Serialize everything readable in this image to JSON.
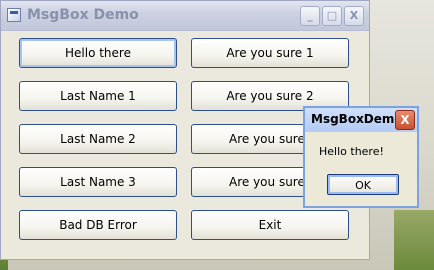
{
  "window": {
    "title": "MsgBox Demo",
    "minimize": "_",
    "maximize": "□",
    "close": "X"
  },
  "buttons": {
    "hello": "Hello there",
    "last1": "Last Name 1",
    "last2": "Last Name 2",
    "last3": "Last Name 3",
    "baddb": "Bad DB Error",
    "sure1": "Are you sure 1",
    "sure2": "Are you sure 2",
    "sure3": "Are you sure",
    "sure4": "Are you sure",
    "exit": "Exit"
  },
  "msgbox": {
    "title": "MsgBoxDemo",
    "close": "X",
    "message": "Hello there!",
    "ok": "OK"
  }
}
